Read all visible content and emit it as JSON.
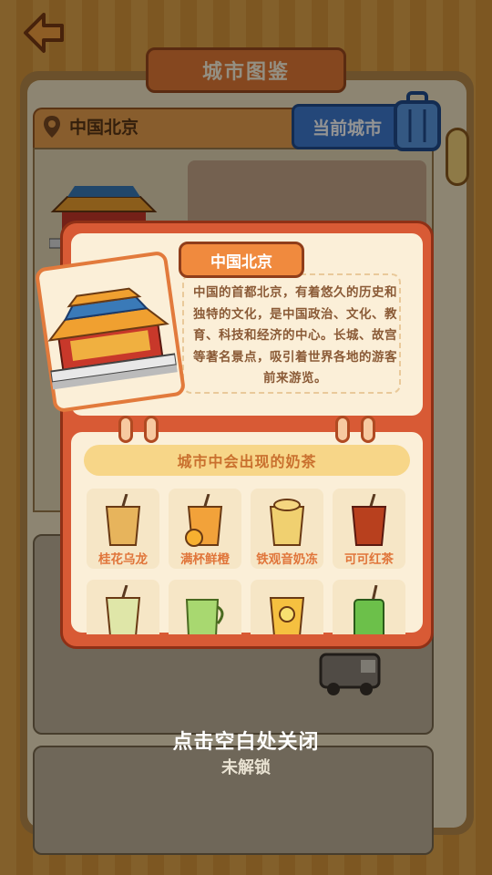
{
  "app": {
    "title": "城市图鉴"
  },
  "location": {
    "name": "中国北京",
    "current_city_label": "当前城市"
  },
  "popup": {
    "city_name": "中国北京",
    "description": "中国的首都北京，有着悠久的历史和独特的文化，是中国政治、文化、教育、科技和经济的中心。长城、故宫等著名景点，吸引着世界各地的游客前来游览。",
    "tea_section_title": "城市中会出现的奶茶",
    "teas": [
      {
        "name": "桂花乌龙",
        "color": "#e7b45c"
      },
      {
        "name": "满杯鲜橙",
        "color": "#f2a23a"
      },
      {
        "name": "铁观音奶冻",
        "color": "#f0d070"
      },
      {
        "name": "可可红茶",
        "color": "#b8401e"
      },
      {
        "name": "",
        "color": "#dfe6a8"
      },
      {
        "name": "",
        "color": "#a8d870"
      },
      {
        "name": "",
        "color": "#f5c040"
      },
      {
        "name": "",
        "color": "#6cc04a"
      }
    ]
  },
  "overlay": {
    "close_hint": "点击空白处关闭",
    "locked_label": "未解锁"
  },
  "colors": {
    "accent": "#e57a36",
    "popup_frame": "#d85a35",
    "current_city": "#3f7bd0"
  },
  "icons": [
    "back-arrow-icon",
    "location-pin-icon",
    "suitcase-icon",
    "palace-icon",
    "food-truck-icon"
  ]
}
